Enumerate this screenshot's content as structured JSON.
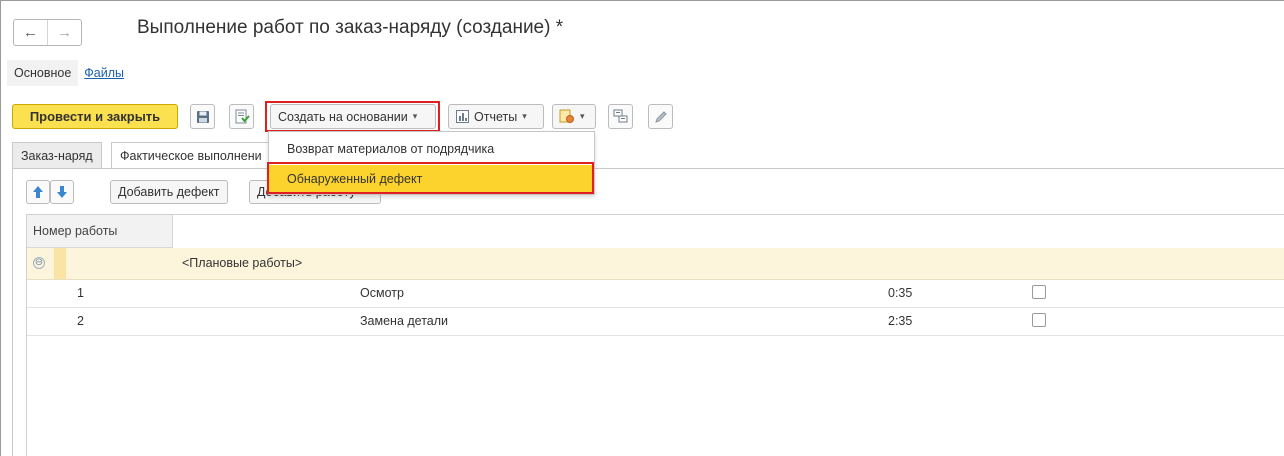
{
  "window": {
    "title": "Выполнение работ по заказ-наряду (создание) *",
    "nav": {
      "back_icon": "←",
      "forward_icon": "→"
    }
  },
  "section_tabs": {
    "main": "Основное",
    "files": "Файлы"
  },
  "toolbar": {
    "post_close": "Провести и закрыть",
    "create_based_on": "Создать на основании",
    "reports": "Отчеты",
    "caret": "▾"
  },
  "dropdown": {
    "items": [
      "Возврат материалов от подрядчика",
      "Обнаруженный дефект"
    ]
  },
  "inner_tabs": [
    "Заказ-наряд",
    "Фактическое выполнени"
  ],
  "subtoolbar": {
    "add_defect": "Добавить дефект",
    "add_work": "Добавить работу"
  },
  "table": {
    "header": "Номер работы",
    "group_label": "<Плановые работы>",
    "group_toggle": "⊖",
    "rows": [
      {
        "num": "1",
        "name": "Осмотр",
        "time": "0:35",
        "checked": false
      },
      {
        "num": "2",
        "name": "Замена детали",
        "time": "2:35",
        "checked": false
      }
    ]
  },
  "colors": {
    "primary": "#fbe04f",
    "highlight": "#fcd22c",
    "annotation": "#e02020",
    "group_row": "#fcf5dc"
  }
}
